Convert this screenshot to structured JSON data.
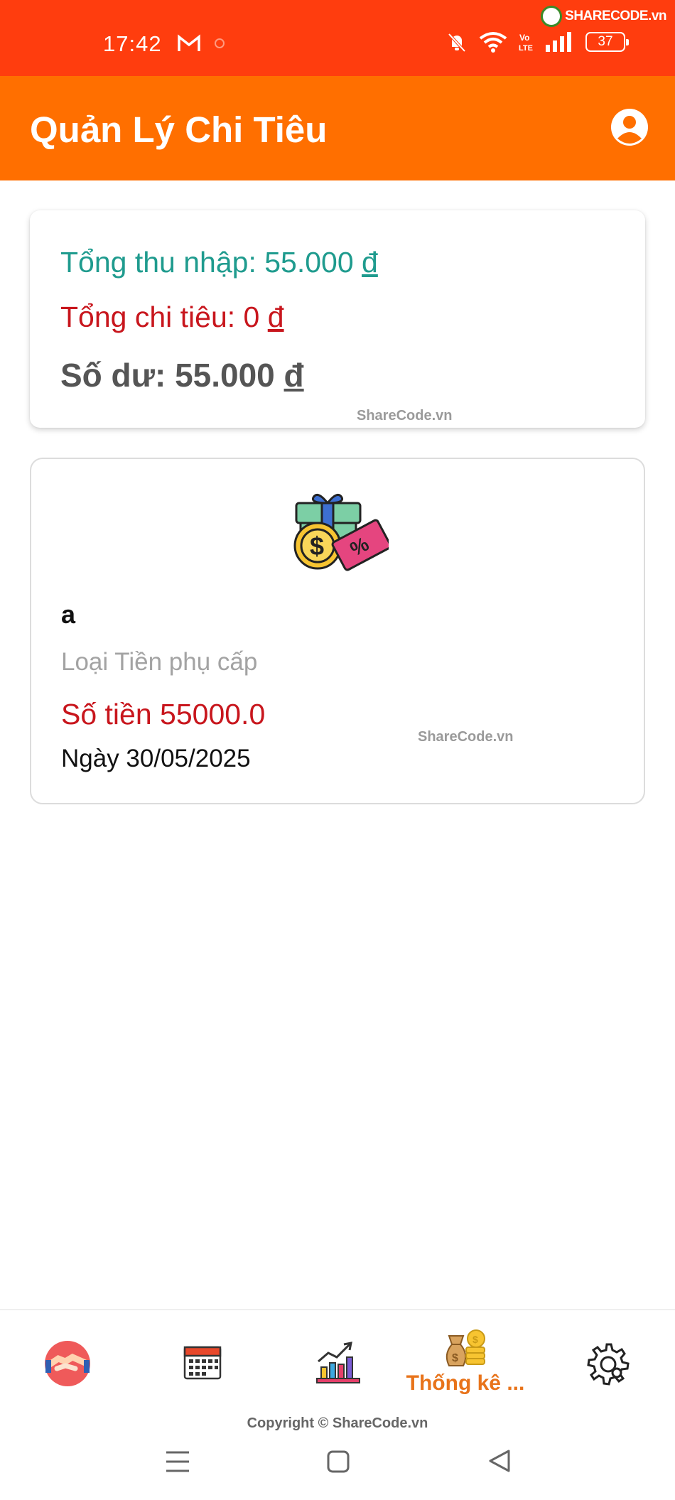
{
  "status_bar": {
    "time": "17:42",
    "battery": "37",
    "network": "Vo LTE",
    "logo_text": "SHARECODE.vn"
  },
  "app_bar": {
    "title": "Quản Lý Chi Tiêu"
  },
  "summary": {
    "income_label": "Tổng thu nhập: 55.000",
    "expense_label": "Tổng chi tiêu: 0",
    "balance_label": "Số dư: 55.000",
    "currency": "đ",
    "watermark": "ShareCode.vn"
  },
  "transactions": [
    {
      "name": "a",
      "type": "Loại Tiền phụ cấp",
      "amount": "Số tiền 55000.0",
      "date": "Ngày 30/05/2025",
      "icon": "gift-money-icon",
      "watermark": "ShareCode.vn"
    }
  ],
  "bottom_nav": {
    "items": [
      {
        "icon": "handshake-icon",
        "label": ""
      },
      {
        "icon": "calendar-icon",
        "label": ""
      },
      {
        "icon": "chart-growth-icon",
        "label": ""
      },
      {
        "icon": "money-bag-icon",
        "label": "Thống kê ..."
      },
      {
        "icon": "gear-icon",
        "label": ""
      }
    ],
    "active_index": 3
  },
  "copyright": "Copyright © ShareCode.vn",
  "colors": {
    "status_bar": "#ff3d0e",
    "app_bar": "#ff6f00",
    "income": "#1f9b8e",
    "expense": "#c8161d",
    "active_nav": "#e8731a"
  }
}
